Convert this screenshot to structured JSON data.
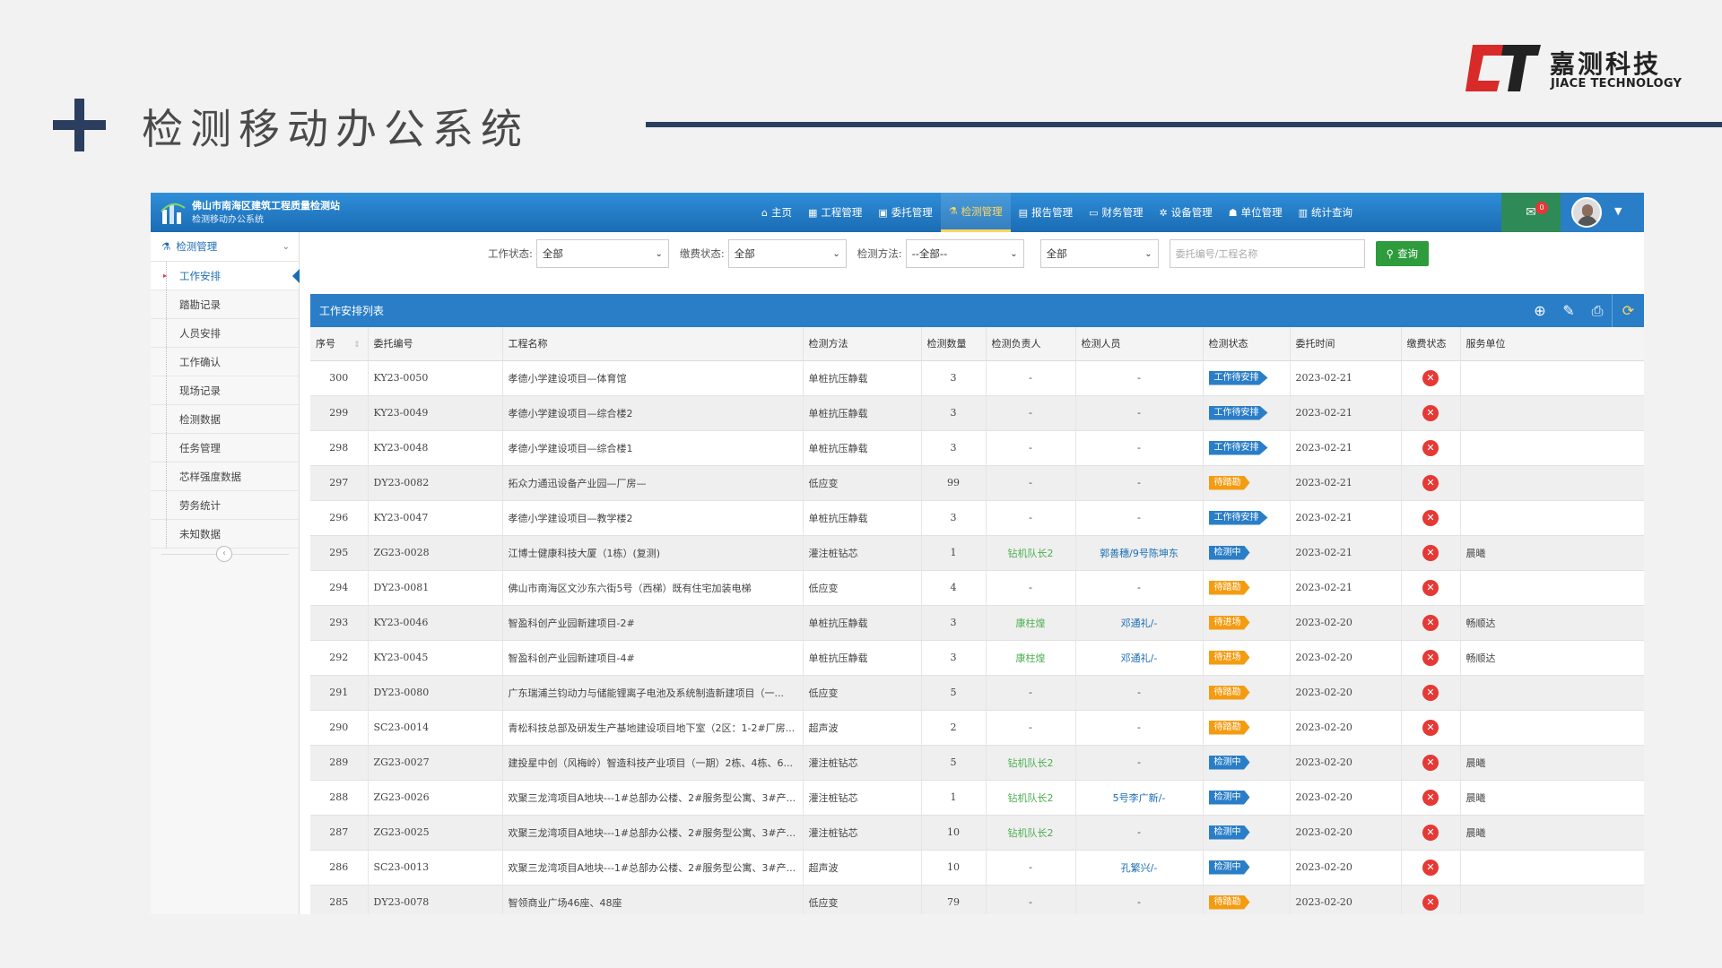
{
  "slide": {
    "title": "检测移动办公系统",
    "brand_cn": "嘉测科技",
    "brand_en": "JIACE TECHNOLOGY"
  },
  "app": {
    "org_name": "佛山市南海区建筑工程质量检测站",
    "sys_name": "检测移动办公系统",
    "nav": [
      {
        "icon": "⌂",
        "icon_name": "home-icon",
        "label": "主页"
      },
      {
        "icon": "▦",
        "icon_name": "project-icon",
        "label": "工程管理"
      },
      {
        "icon": "▣",
        "icon_name": "entrust-icon",
        "label": "委托管理"
      },
      {
        "icon": "⚗",
        "icon_name": "flask-icon",
        "label": "检测管理"
      },
      {
        "icon": "▤",
        "icon_name": "report-icon",
        "label": "报告管理"
      },
      {
        "icon": "▭",
        "icon_name": "finance-icon",
        "label": "财务管理"
      },
      {
        "icon": "✲",
        "icon_name": "equipment-icon",
        "label": "设备管理"
      },
      {
        "icon": "☗",
        "icon_name": "unit-icon",
        "label": "单位管理"
      },
      {
        "icon": "▥",
        "icon_name": "stats-icon",
        "label": "统计查询"
      }
    ],
    "active_nav": 3,
    "mail_count": "0"
  },
  "sidebar": {
    "section": "检测管理",
    "items": [
      "工作安排",
      "踏勘记录",
      "人员安排",
      "工作确认",
      "现场记录",
      "检测数据",
      "任务管理",
      "芯样强度数据",
      "劳务统计",
      "未知数据"
    ],
    "active": 0
  },
  "filters": {
    "work_status_label": "工作状态:",
    "work_status_value": "全部",
    "pay_status_label": "缴费状态:",
    "pay_status_value": "全部",
    "method_label": "检测方法:",
    "method_value": "--全部--",
    "extra_value": "全部",
    "search_placeholder": "委托编号/工程名称",
    "query_label": "查询"
  },
  "table": {
    "title": "工作安排列表",
    "columns": [
      "序号",
      "委托编号",
      "工程名称",
      "检测方法",
      "检测数量",
      "检测负责人",
      "检测人员",
      "检测状态",
      "委托时间",
      "缴费状态",
      "服务单位"
    ],
    "rows": [
      {
        "no": "300",
        "code": "KY23-0050",
        "name": "孝德小学建设项目—体育馆",
        "method": "单桩抗压静载",
        "qty": "3",
        "lead": "-",
        "staff": "-",
        "status": "工作待安排",
        "status_color": "#2a7ec7",
        "date": "2023-02-21",
        "unit": ""
      },
      {
        "no": "299",
        "code": "KY23-0049",
        "name": "孝德小学建设项目—综合楼2",
        "method": "单桩抗压静载",
        "qty": "3",
        "lead": "-",
        "staff": "-",
        "status": "工作待安排",
        "status_color": "#2a7ec7",
        "date": "2023-02-21",
        "unit": ""
      },
      {
        "no": "298",
        "code": "KY23-0048",
        "name": "孝德小学建设项目—综合楼1",
        "method": "单桩抗压静载",
        "qty": "3",
        "lead": "-",
        "staff": "-",
        "status": "工作待安排",
        "status_color": "#2a7ec7",
        "date": "2023-02-21",
        "unit": ""
      },
      {
        "no": "297",
        "code": "DY23-0082",
        "name": "拓众力通迅设备产业园—厂房—",
        "method": "低应变",
        "qty": "99",
        "lead": "-",
        "staff": "-",
        "status": "待踏勘",
        "status_color": "#f39c12",
        "date": "2023-02-21",
        "unit": ""
      },
      {
        "no": "296",
        "code": "KY23-0047",
        "name": "孝德小学建设项目—教学楼2",
        "method": "单桩抗压静载",
        "qty": "3",
        "lead": "-",
        "staff": "-",
        "status": "工作待安排",
        "status_color": "#2a7ec7",
        "date": "2023-02-21",
        "unit": ""
      },
      {
        "no": "295",
        "code": "ZG23-0028",
        "name": "江博士健康科技大厦（1栋）(复测)",
        "method": "灌注桩钻芯",
        "qty": "1",
        "lead": "钻机队长2",
        "staff": "郭善穗/9号陈坤东",
        "status": "检测中",
        "status_color": "#2a7ec7",
        "date": "2023-02-21",
        "unit": "晨曦"
      },
      {
        "no": "294",
        "code": "DY23-0081",
        "name": "佛山市南海区文沙东六街5号（西梯）既有住宅加装电梯",
        "method": "低应变",
        "qty": "4",
        "lead": "-",
        "staff": "-",
        "status": "待踏勘",
        "status_color": "#f39c12",
        "date": "2023-02-21",
        "unit": ""
      },
      {
        "no": "293",
        "code": "KY23-0046",
        "name": "智盈科创产业园新建项目-2#",
        "method": "单桩抗压静载",
        "qty": "3",
        "lead": "康柱煌",
        "staff": "邓通礼/-",
        "status": "待进场",
        "status_color": "#f39c12",
        "date": "2023-02-20",
        "unit": "畅顺达"
      },
      {
        "no": "292",
        "code": "KY23-0045",
        "name": "智盈科创产业园新建项目-4#",
        "method": "单桩抗压静载",
        "qty": "3",
        "lead": "康柱煌",
        "staff": "邓通礼/-",
        "status": "待进场",
        "status_color": "#f39c12",
        "date": "2023-02-20",
        "unit": "畅顺达"
      },
      {
        "no": "291",
        "code": "DY23-0080",
        "name": "广东瑞浦兰钧动力与储能锂离子电池及系统制造新建项目（一...",
        "method": "低应变",
        "qty": "5",
        "lead": "-",
        "staff": "-",
        "status": "待踏勘",
        "status_color": "#f39c12",
        "date": "2023-02-20",
        "unit": ""
      },
      {
        "no": "290",
        "code": "SC23-0014",
        "name": "青松科技总部及研发生产基地建设项目地下室（2区：1-2#厂房...",
        "method": "超声波",
        "qty": "2",
        "lead": "-",
        "staff": "-",
        "status": "待踏勘",
        "status_color": "#f39c12",
        "date": "2023-02-20",
        "unit": ""
      },
      {
        "no": "289",
        "code": "ZG23-0027",
        "name": "建投星中创（风梅岭）智造科技产业项目（一期）2栋、4栋、6...",
        "method": "灌注桩钻芯",
        "qty": "5",
        "lead": "钻机队长2",
        "staff": "-",
        "status": "检测中",
        "status_color": "#2a7ec7",
        "date": "2023-02-20",
        "unit": "晨曦"
      },
      {
        "no": "288",
        "code": "ZG23-0026",
        "name": "欢聚三龙湾项目A地块---1#总部办公楼、2#服务型公寓、3#产...",
        "method": "灌注桩钻芯",
        "qty": "1",
        "lead": "钻机队长2",
        "staff": "5号李广新/-",
        "status": "检测中",
        "status_color": "#2a7ec7",
        "date": "2023-02-20",
        "unit": "晨曦"
      },
      {
        "no": "287",
        "code": "ZG23-0025",
        "name": "欢聚三龙湾项目A地块---1#总部办公楼、2#服务型公寓、3#产...",
        "method": "灌注桩钻芯",
        "qty": "10",
        "lead": "钻机队长2",
        "staff": "-",
        "status": "检测中",
        "status_color": "#2a7ec7",
        "date": "2023-02-20",
        "unit": "晨曦"
      },
      {
        "no": "286",
        "code": "SC23-0013",
        "name": "欢聚三龙湾项目A地块---1#总部办公楼、2#服务型公寓、3#产...",
        "method": "超声波",
        "qty": "10",
        "lead": "-",
        "staff": "孔繁兴/-",
        "status": "检测中",
        "status_color": "#2a7ec7",
        "date": "2023-02-20",
        "unit": ""
      },
      {
        "no": "285",
        "code": "DY23-0078",
        "name": "智领商业广场46座、48座",
        "method": "低应变",
        "qty": "79",
        "lead": "-",
        "staff": "-",
        "status": "待踏勘",
        "status_color": "#f39c12",
        "date": "2023-02-20",
        "unit": ""
      }
    ]
  }
}
